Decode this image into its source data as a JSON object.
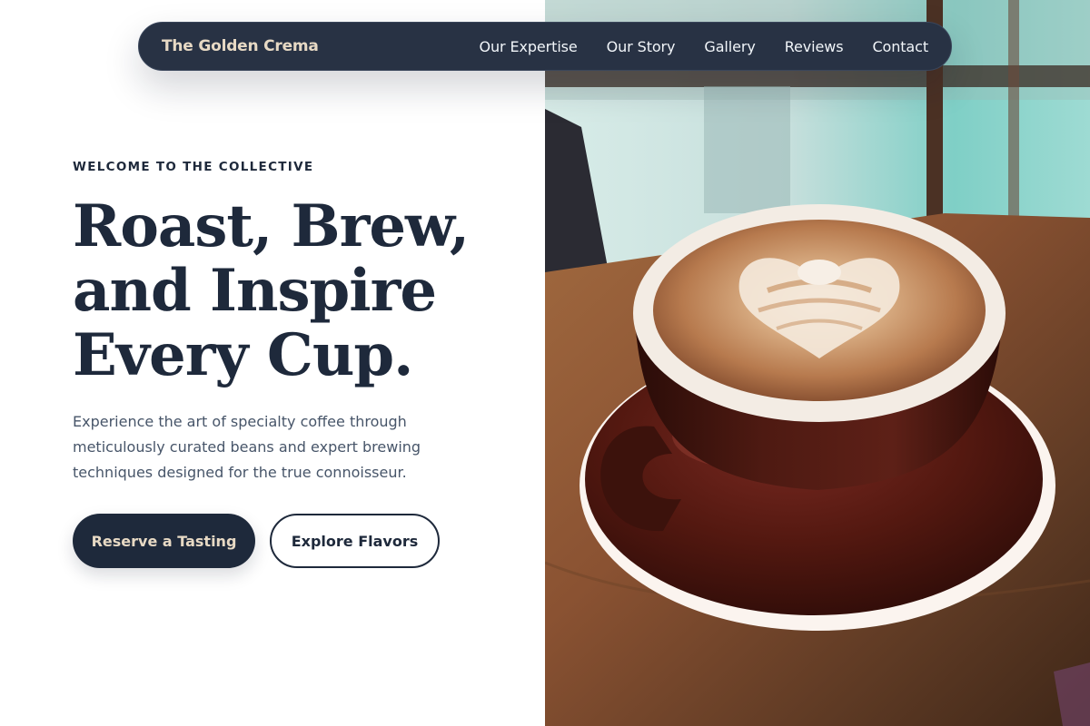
{
  "colors": {
    "navy": "#1e293b",
    "nav_background": "#283244",
    "cream_accent": "#e7d9c4",
    "body_text_gray": "#475569",
    "page_background": "#ffffff"
  },
  "nav": {
    "brand": "The Golden Crema",
    "links": [
      {
        "label": "Our Expertise"
      },
      {
        "label": "Our Story"
      },
      {
        "label": "Gallery"
      },
      {
        "label": "Reviews"
      },
      {
        "label": "Contact"
      }
    ]
  },
  "hero": {
    "eyebrow": "WELCOME TO THE COLLECTIVE",
    "headline_lines": [
      "Roast, Brew,",
      "and Inspire",
      "Every Cup."
    ],
    "lead_lines": [
      "Experience the art of specialty coffee through",
      "meticulously curated beans and expert brewing",
      "techniques designed for the true connoisseur."
    ],
    "primary_cta": "Reserve a Tasting",
    "secondary_cta": "Explore Flavors",
    "image": {
      "subject": "cappuccino-with-latte-art-photo"
    }
  }
}
